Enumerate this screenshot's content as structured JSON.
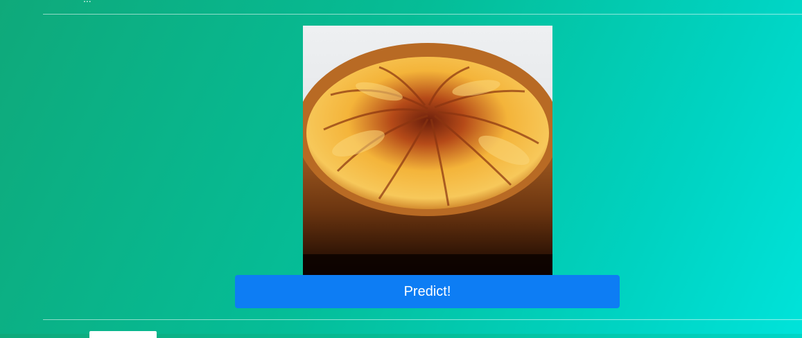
{
  "header": {
    "partial_text": "..."
  },
  "preview": {
    "image_name": "tart-photo",
    "colors": {
      "background": "#e8eaec",
      "crust": "#9a5a1a",
      "filling": "#f0b020",
      "caramel": "#7a2a10"
    }
  },
  "predict_button": {
    "label": "Predict!",
    "color": "#0d7df4"
  }
}
